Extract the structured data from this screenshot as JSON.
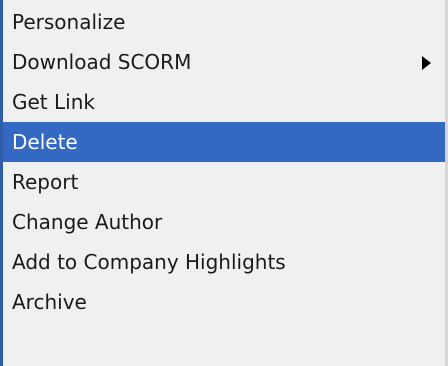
{
  "menu": {
    "items": [
      {
        "label": "Personalize"
      },
      {
        "label": "Download SCORM",
        "has_submenu": true
      },
      {
        "label": "Get Link"
      },
      {
        "label": "Delete",
        "selected": true
      },
      {
        "label": "Report"
      },
      {
        "label": "Change Author"
      },
      {
        "label": "Add to Company Highlights"
      },
      {
        "label": "Archive"
      },
      {
        "label": ""
      }
    ]
  },
  "colors": {
    "menu_background": "#f0f0f0",
    "selection_background": "#3369c3",
    "selection_text": "#ffffff",
    "left_border": "#2e5dab",
    "text": "#1a1a1a"
  },
  "icons": {
    "submenu_arrow": "chevron-right-icon"
  }
}
